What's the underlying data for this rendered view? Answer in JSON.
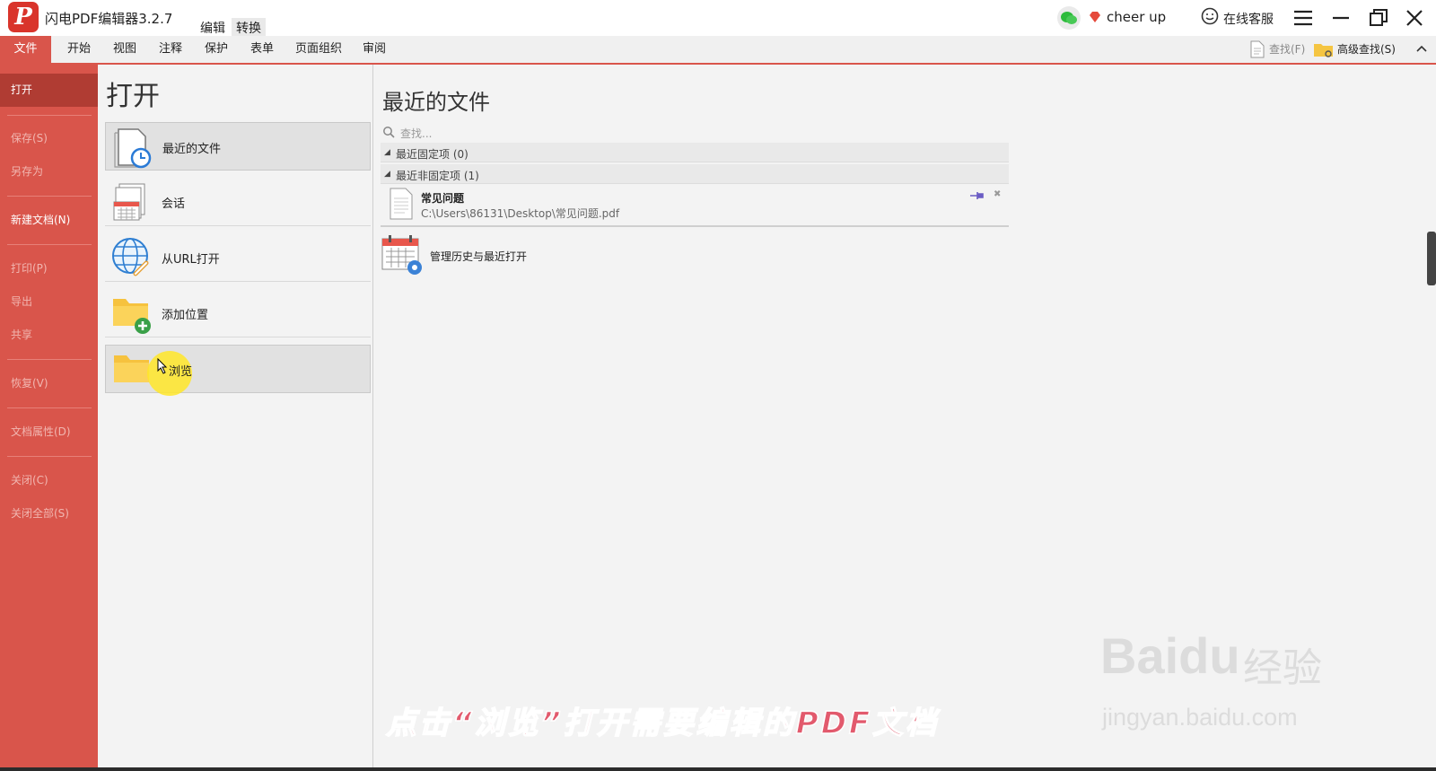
{
  "app": {
    "title": "闪电PDF编辑器3.2.7",
    "logo_letter": "P"
  },
  "top_tabs": [
    "编辑",
    "转换"
  ],
  "account": {
    "user": "cheer up",
    "support": "在线客服"
  },
  "ribbon": {
    "tabs": [
      "文件",
      "开始",
      "视图",
      "注释",
      "保护",
      "表单",
      "页面组织",
      "审阅"
    ],
    "find": "查找(F)",
    "advanced_find": "高级查找(S)"
  },
  "sidebar": {
    "items": [
      "打开",
      "保存(S)",
      "另存为",
      "新建文档(N)",
      "打印(P)",
      "导出",
      "共享",
      "恢复(V)",
      "文档属性(D)",
      "关闭(C)",
      "关闭全部(S)"
    ]
  },
  "open_panel": {
    "title": "打开",
    "items": [
      "最近的文件",
      "会话",
      "从URL打开",
      "添加位置",
      "浏览"
    ]
  },
  "recent": {
    "title": "最近的文件",
    "search_placeholder": "查找...",
    "pinned_header": "最近固定项 (0)",
    "unpinned_header": "最近非固定项 (1)",
    "file_name": "常见问题",
    "file_path": "C:\\Users\\86131\\Desktop\\常见问题.pdf",
    "history": "管理历史与最近打开"
  },
  "overlay": {
    "caption": "点击“浏览”打开需要编辑的PDF文档",
    "watermark_logo": "Baidu",
    "watermark_cn": "经验",
    "watermark_url": "jingyan.baidu.com"
  },
  "colors": {
    "accent": "#d9554b",
    "sidebar_active": "#b03c33",
    "caption": "#e25a6d"
  }
}
